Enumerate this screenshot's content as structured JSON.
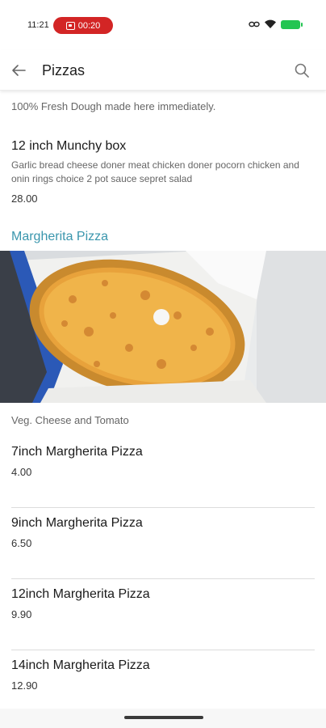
{
  "status_bar": {
    "time": "11:21",
    "recording_time": "00:20",
    "recording_color": "#d32525",
    "battery_color": "#23c552",
    "icons": [
      "screen-record-icon",
      "link-icon",
      "wifi-icon",
      "battery-icon"
    ]
  },
  "header": {
    "title": "Pizzas",
    "back_icon": "arrow-left-icon",
    "search_icon": "search-icon"
  },
  "intro": "100% Fresh Dough made here immediately.",
  "munchy_box": {
    "title": "12 inch Munchy box",
    "description": "Garlic bread cheese doner meat chicken doner pocorn chicken and onin rings choice 2 pot sauce sepret salad",
    "price": "28.00"
  },
  "section": {
    "title": "Margherita Pizza",
    "title_color": "#3a96ad",
    "description": "Veg. Cheese and Tomato",
    "items": [
      {
        "title": "7inch Margherita Pizza",
        "price": "4.00"
      },
      {
        "title": "9inch Margherita Pizza",
        "price": "6.50"
      },
      {
        "title": "12inch Margherita Pizza",
        "price": "9.90"
      },
      {
        "title": "14inch Margherita Pizza",
        "price": "12.90"
      }
    ]
  }
}
